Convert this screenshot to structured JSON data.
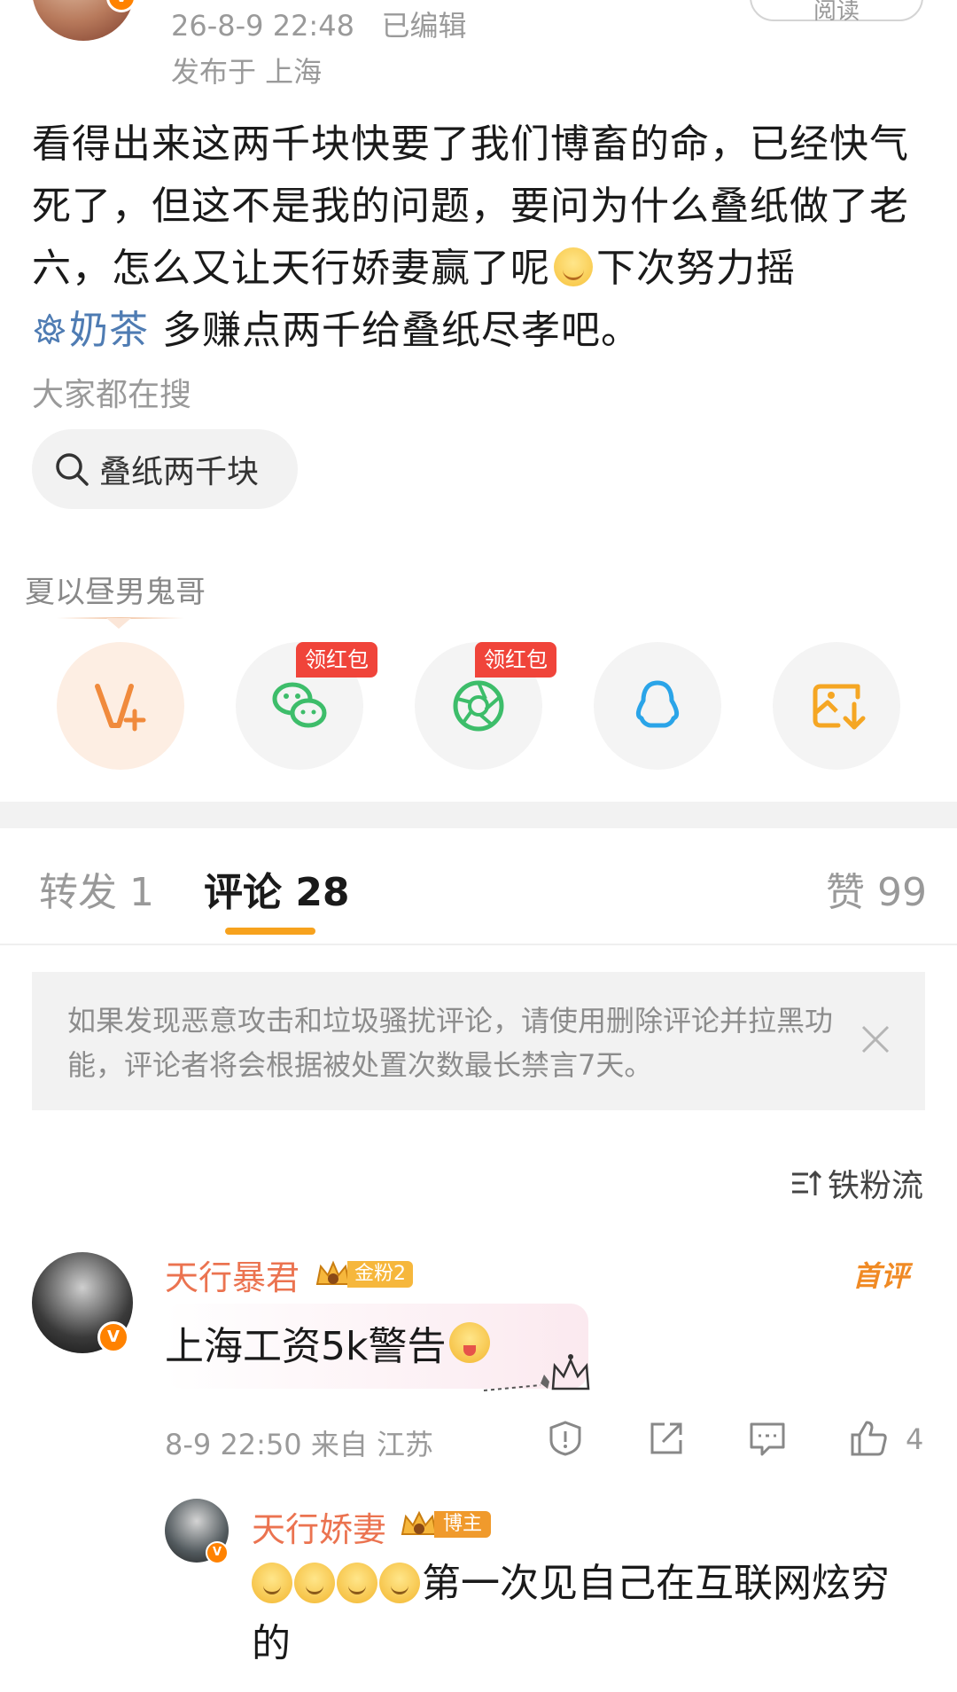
{
  "post": {
    "timestamp": "26-8-9 22:48",
    "edited": "已编辑",
    "location": "发布于 上海",
    "read_label": "阅读",
    "text_part1": "看得出来这两千块快要了我们博畜的命，已经快气死了，但这不是我的问题，要问为什么叠纸做了老六，怎么又让天行娇妻赢了呢",
    "text_part2": "下次努力摇",
    "topic": "奶茶",
    "text_part3": " 多赚点两千给叠纸尽孝吧。"
  },
  "search": {
    "hint": "大家都在搜",
    "chip": "叠纸两千块"
  },
  "share": {
    "label": "夏以昼男鬼哥",
    "red_tag": "领红包",
    "buttons": [
      "vplus-icon",
      "wechat-icon",
      "moments-icon",
      "qq-icon",
      "save-image-icon"
    ]
  },
  "tabs": {
    "repost": "转发 1",
    "comments": "评论 28",
    "likes": "赞 99"
  },
  "notice": {
    "text": "如果发现恶意攻击和垃圾骚扰评论，请使用删除评论并拉黑功能，评论者将会根据被处置次数最长禁言7天。"
  },
  "sort": {
    "label": "铁粉流"
  },
  "comment": {
    "name": "天行暴君",
    "fan_badge": "金粉2",
    "first_tag": "首评",
    "text": "上海工资5k警告",
    "time_location": "8-9 22:50  来自 江苏",
    "like_count": "4"
  },
  "reply": {
    "name": "天行娇妻",
    "badge": "博主",
    "text": "第一次见自己在互联网炫穷的"
  },
  "colors": {
    "accent_orange": "#ff8200",
    "username": "#eb7350",
    "topic_blue": "#4f7cb3",
    "tab_underline": "#f7a21d",
    "red_tag": "#f0443a"
  }
}
